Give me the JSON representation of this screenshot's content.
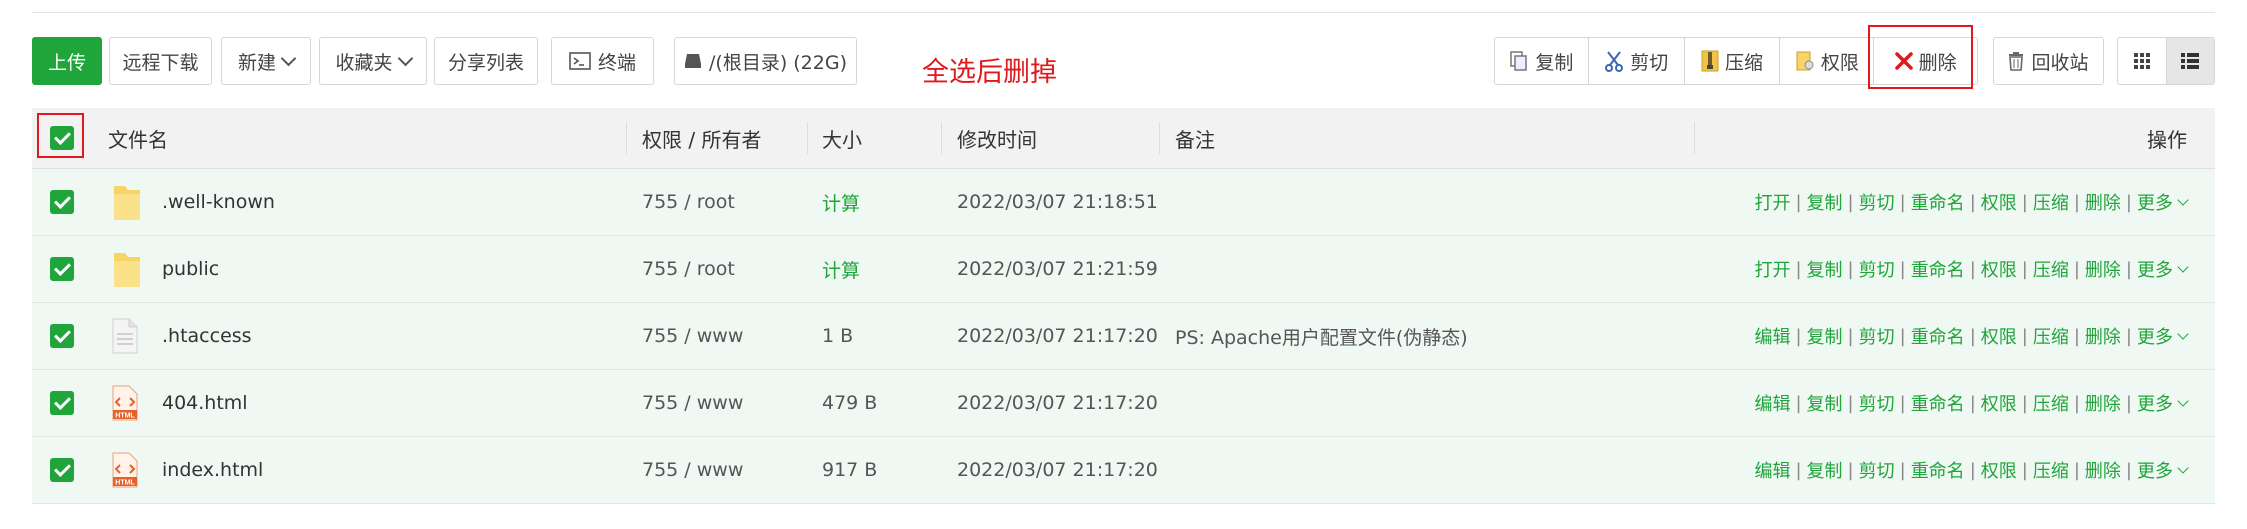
{
  "toolbar": {
    "upload": "上传",
    "remote_download": "远程下载",
    "new": "新建",
    "favorites": "收藏夹",
    "share_list": "分享列表",
    "terminal": "终端",
    "disk": "/(根目录) (22G)",
    "batch": {
      "copy": "复制",
      "cut": "剪切",
      "compress": "压缩",
      "permission": "权限",
      "delete": "删除"
    },
    "recycle": "回收站"
  },
  "annotation": "全选后删掉",
  "columns": {
    "name": "文件名",
    "perm": "权限 / 所有者",
    "size": "大小",
    "mtime": "修改时间",
    "note": "备注",
    "ops": "操作"
  },
  "rows": [
    {
      "name": ".well-known",
      "perm": "755 / root",
      "size": "计算",
      "mtime": "2022/03/07 21:18:51",
      "note": "",
      "type": "folder",
      "first_op": "打开"
    },
    {
      "name": "public",
      "perm": "755 / root",
      "size": "计算",
      "mtime": "2022/03/07 21:21:59",
      "note": "",
      "type": "folder",
      "first_op": "打开"
    },
    {
      "name": ".htaccess",
      "perm": "755 / www",
      "size": "1 B",
      "mtime": "2022/03/07 21:17:20",
      "note": "PS: Apache用户配置文件(伪静态)",
      "type": "file",
      "first_op": "编辑"
    },
    {
      "name": "404.html",
      "perm": "755 / www",
      "size": "479 B",
      "mtime": "2022/03/07 21:17:20",
      "note": "",
      "type": "html",
      "first_op": "编辑"
    },
    {
      "name": "index.html",
      "perm": "755 / www",
      "size": "917 B",
      "mtime": "2022/03/07 21:17:20",
      "note": "",
      "type": "html",
      "first_op": "编辑"
    }
  ],
  "row_ops": [
    "复制",
    "剪切",
    "重命名",
    "权限",
    "压缩",
    "删除",
    "更多"
  ],
  "html_badge": "HTML",
  "colors": {
    "accent": "#20a53a",
    "danger": "#e0191e",
    "row_bg": "#eff8f3"
  }
}
